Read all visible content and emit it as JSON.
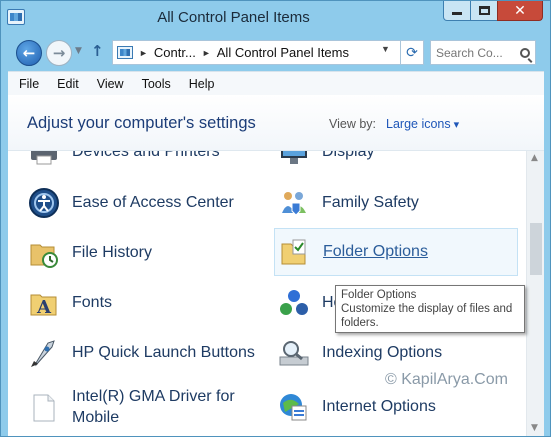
{
  "window": {
    "title": "All Control Panel Items",
    "close_glyph": "✕"
  },
  "nav": {
    "back_glyph": "←",
    "forward_glyph": "→",
    "up_glyph": "↑",
    "refresh_glyph": "⟳"
  },
  "address": {
    "segments": [
      "Contr...",
      "All Control Panel Items"
    ],
    "separator": "►"
  },
  "search": {
    "placeholder": "Search Co..."
  },
  "menubar": [
    "File",
    "Edit",
    "View",
    "Tools",
    "Help"
  ],
  "header": {
    "heading": "Adjust your computer's settings",
    "view_by_label": "View by:",
    "view_by_value": "Large icons"
  },
  "items_left": [
    {
      "label": "Devices and Printers",
      "icon": "printer-icon"
    },
    {
      "label": "Ease of Access Center",
      "icon": "ease-of-access-icon"
    },
    {
      "label": "File History",
      "icon": "file-history-icon"
    },
    {
      "label": "Fonts",
      "icon": "fonts-folder-icon"
    },
    {
      "label": "HP Quick Launch Buttons",
      "icon": "rocket-icon"
    },
    {
      "label": "Intel(R) GMA Driver for",
      "label2": "Mobile",
      "icon": "document-icon"
    }
  ],
  "items_right": [
    {
      "label": "Display",
      "icon": "monitor-icon"
    },
    {
      "label": "Family Safety",
      "icon": "family-safety-icon"
    },
    {
      "label": "Folder Options",
      "icon": "folder-options-icon"
    },
    {
      "label": "Ho",
      "icon": "homegroup-icon"
    },
    {
      "label": "Indexing Options",
      "icon": "indexing-icon"
    },
    {
      "label": "Internet Options",
      "icon": "internet-options-icon"
    }
  ],
  "tooltip": {
    "title": "Folder Options",
    "line1": "Customize the display of files and",
    "line2": "folders."
  },
  "watermark": "© KapilArya.Com"
}
